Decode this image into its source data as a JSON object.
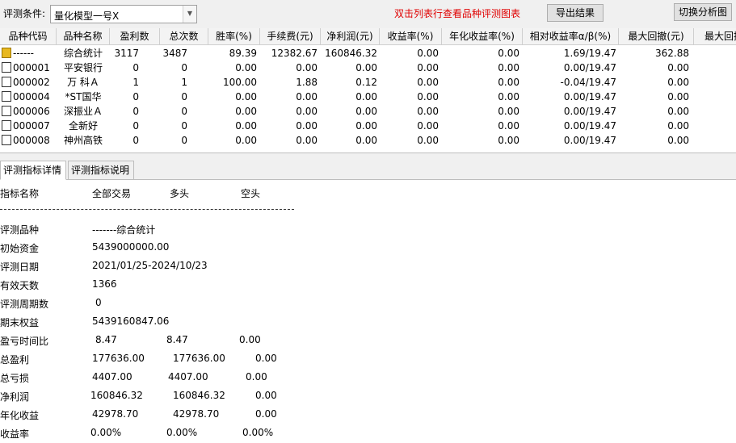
{
  "toolbar": {
    "condition_label": "评测条件:",
    "model_value": "量化模型一号X",
    "hint": "双击列表行查看品种评测图表",
    "export_label": "导出结果",
    "switch_label": "切换分析图"
  },
  "table": {
    "headers": [
      "品种代码",
      "品种名称",
      "盈利数",
      "总次数",
      "胜率(%)",
      "手续费(元)",
      "净利润(元)",
      "收益率(%)",
      "年化收益率(%)",
      "相对收益率α/β(%)",
      "最大回撤(元)",
      "最大回撤"
    ],
    "rows": [
      [
        "------",
        "综合统计",
        "3117",
        "3487",
        "89.39",
        "12382.67",
        "160846.32",
        "0.00",
        "0.00",
        "1.69/19.47",
        "362.88"
      ],
      [
        "000001",
        "平安银行",
        "0",
        "0",
        "0.00",
        "0.00",
        "0.00",
        "0.00",
        "0.00",
        "0.00/19.47",
        "0.00"
      ],
      [
        "000002",
        "万 科Ａ",
        "1",
        "1",
        "100.00",
        "1.88",
        "0.12",
        "0.00",
        "0.00",
        "-0.04/19.47",
        "0.00"
      ],
      [
        "000004",
        "*ST国华",
        "0",
        "0",
        "0.00",
        "0.00",
        "0.00",
        "0.00",
        "0.00",
        "0.00/19.47",
        "0.00"
      ],
      [
        "000006",
        "深振业Ａ",
        "0",
        "0",
        "0.00",
        "0.00",
        "0.00",
        "0.00",
        "0.00",
        "0.00/19.47",
        "0.00"
      ],
      [
        "000007",
        "全新好",
        "0",
        "0",
        "0.00",
        "0.00",
        "0.00",
        "0.00",
        "0.00",
        "0.00/19.47",
        "0.00"
      ],
      [
        "000008",
        "神州高铁",
        "0",
        "0",
        "0.00",
        "0.00",
        "0.00",
        "0.00",
        "0.00",
        "0.00/19.47",
        "0.00"
      ]
    ]
  },
  "tabs": {
    "detail_label": "评测指标详情",
    "explain_label": "评测指标说明"
  },
  "detail": {
    "headers": [
      "指标名称",
      "全部交易",
      "多头",
      "空头"
    ],
    "dashes": "------------------------------------------------------------",
    "rows": [
      {
        "name": "评测品种",
        "all": "-------综合统计",
        "long": "",
        "short": ""
      },
      {
        "name": "初始资金",
        "all": "5439000000.00",
        "long": "",
        "short": ""
      },
      {
        "name": "评测日期",
        "all": "2021/01/25-2024/10/23",
        "long": "",
        "short": ""
      },
      {
        "name": "有效天数",
        "all": "1366",
        "long": "",
        "short": ""
      },
      {
        "name": "评测周期数",
        "all": "0",
        "long": "",
        "short": ""
      },
      {
        "name": "期末权益",
        "all": "5439160847.06",
        "long": "",
        "short": ""
      },
      {
        "name": "盈亏时间比",
        "all": "8.47",
        "long": "8.47",
        "short": "0.00"
      },
      {
        "name": "总盈利",
        "all": "177636.00",
        "long": "177636.00",
        "short": "0.00"
      },
      {
        "name": "总亏损",
        "all": "4407.00",
        "long": "4407.00",
        "short": "0.00"
      },
      {
        "name": "净利润",
        "all": "160846.32",
        "long": "160846.32",
        "short": "0.00"
      },
      {
        "name": "年化收益",
        "all": "42978.70",
        "long": "42978.70",
        "short": "0.00"
      },
      {
        "name": "收益率",
        "all": "0.00%",
        "long": "0.00%",
        "short": "0.00%"
      }
    ]
  }
}
